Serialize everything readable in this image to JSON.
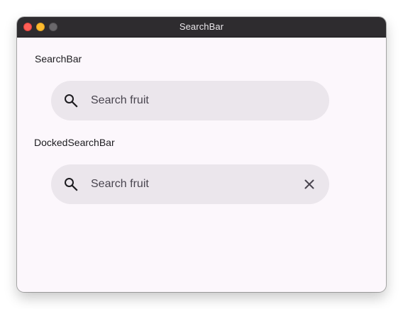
{
  "window": {
    "title": "SearchBar"
  },
  "sections": [
    {
      "label": "SearchBar",
      "search": {
        "placeholder": "Search fruit",
        "value": "",
        "leading_icon": "search-icon"
      }
    },
    {
      "label": "DockedSearchBar",
      "search": {
        "placeholder": "Search fruit",
        "value": "",
        "leading_icon": "search-icon",
        "trailing_icon": "close-icon"
      }
    }
  ],
  "colors": {
    "window_background": "#fcf7fc",
    "search_container": "#ebe6ec",
    "text_primary": "#1c1b1f",
    "text_secondary": "#49454f",
    "titlebar": "#2e2c2f"
  }
}
